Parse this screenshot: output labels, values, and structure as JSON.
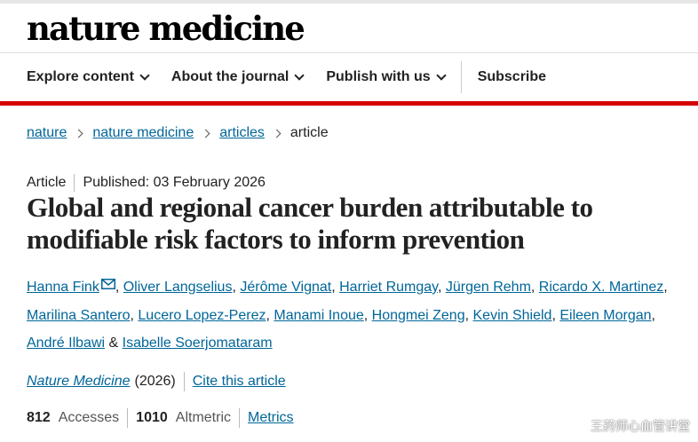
{
  "header": {
    "logo": "nature medicine",
    "nav": [
      {
        "label": "Explore content",
        "dropdown": true
      },
      {
        "label": "About the journal",
        "dropdown": true
      },
      {
        "label": "Publish with us",
        "dropdown": true
      },
      {
        "label": "Subscribe",
        "dropdown": false
      }
    ]
  },
  "breadcrumb": {
    "items": [
      "nature",
      "nature medicine",
      "articles"
    ],
    "current": "article"
  },
  "article": {
    "type": "Article",
    "published": "Published: 03 February 2026",
    "title": "Global and regional cancer burden attributable to modifiable risk factors to inform prevention",
    "authors": [
      "Hanna Fink",
      "Oliver Langselius",
      "Jérôme Vignat",
      "Harriet Rumgay",
      "Jürgen Rehm",
      "Ricardo X. Martinez",
      "Marilina Santero",
      "Lucero Lopez-Perez",
      "Manami Inoue",
      "Hongmei Zeng",
      "Kevin Shield",
      "Eileen Morgan",
      "André Ilbawi",
      "Isabelle Soerjomataram"
    ],
    "author_and": "&",
    "journal": "Nature Medicine",
    "year": "(2026)",
    "cite_label": "Cite this article"
  },
  "metrics": {
    "accesses_value": "812",
    "accesses_label": "Accesses",
    "altmetric_value": "1010",
    "altmetric_label": "Altmetric",
    "metrics_link": "Metrics"
  },
  "watermark": "王药师心血管讲堂",
  "colors": {
    "accent_red": "#d40000",
    "link": "#006699",
    "text": "#222222"
  }
}
